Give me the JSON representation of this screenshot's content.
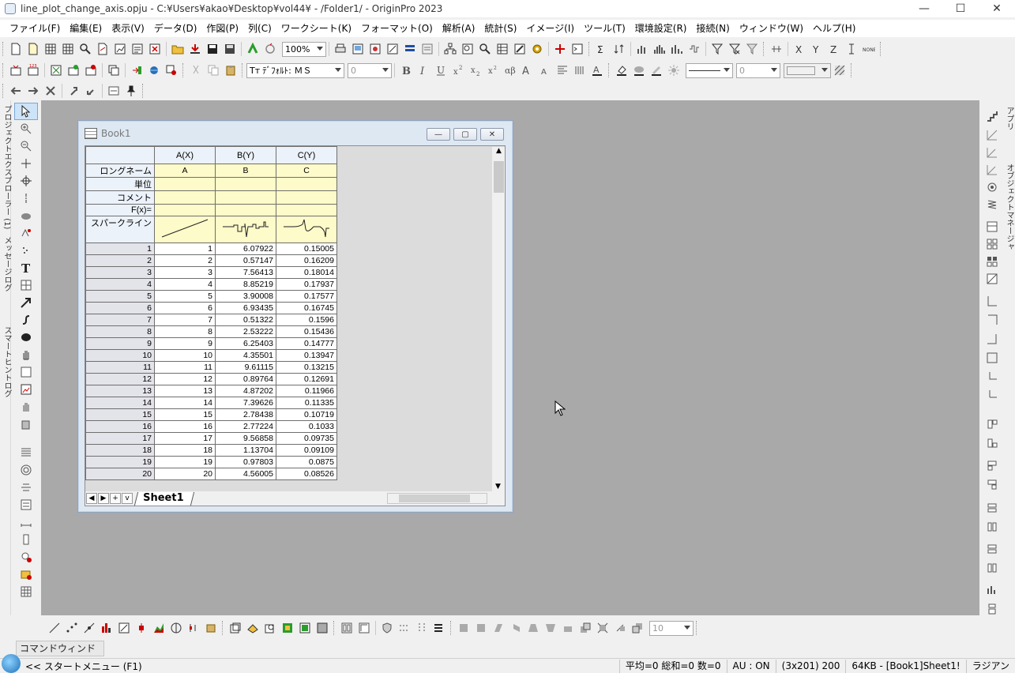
{
  "window": {
    "title": "line_plot_change_axis.opju - C:¥Users¥akao¥Desktop¥vol44¥ - /Folder1/ - OriginPro 2023"
  },
  "menu": [
    "ファイル(F)",
    "編集(E)",
    "表示(V)",
    "データ(D)",
    "作図(P)",
    "列(C)",
    "ワークシート(K)",
    "フォーマット(O)",
    "解析(A)",
    "統計(S)",
    "イメージ(I)",
    "ツール(T)",
    "環境設定(R)",
    "接続(N)",
    "ウィンドウ(W)",
    "ヘルプ(H)"
  ],
  "toolbar": {
    "zoom_value": "100%",
    "font_name": "ﾃﾞﾌｫﾙﾄ: ＭＳ",
    "font_size": "0",
    "line_width": "0",
    "bottom_size": "10"
  },
  "left_tabs": [
    "プロジェクトエクスプローラー (1)",
    "メッセージログ",
    "スマートヒントログ"
  ],
  "right_tabs": [
    "アプリ",
    "オブジェクトマネージャ"
  ],
  "book": {
    "title": "Book1",
    "columns": [
      "A(X)",
      "B(Y)",
      "C(Y)"
    ],
    "meta_labels": [
      "ロングネーム",
      "単位",
      "コメント",
      "F(x)=",
      "スパークライン"
    ],
    "long_names": [
      "A",
      "B",
      "C"
    ],
    "rows": [
      [
        "1",
        "1",
        "6.07922",
        "0.15005"
      ],
      [
        "2",
        "2",
        "0.57147",
        "0.16209"
      ],
      [
        "3",
        "3",
        "7.56413",
        "0.18014"
      ],
      [
        "4",
        "4",
        "8.85219",
        "0.17937"
      ],
      [
        "5",
        "5",
        "3.90008",
        "0.17577"
      ],
      [
        "6",
        "6",
        "6.93435",
        "0.16745"
      ],
      [
        "7",
        "7",
        "0.51322",
        "0.1596"
      ],
      [
        "8",
        "8",
        "2.53222",
        "0.15436"
      ],
      [
        "9",
        "9",
        "6.25403",
        "0.14777"
      ],
      [
        "10",
        "10",
        "4.35501",
        "0.13947"
      ],
      [
        "11",
        "11",
        "9.61115",
        "0.13215"
      ],
      [
        "12",
        "12",
        "0.89764",
        "0.12691"
      ],
      [
        "13",
        "13",
        "4.87202",
        "0.11966"
      ],
      [
        "14",
        "14",
        "7.39626",
        "0.11335"
      ],
      [
        "15",
        "15",
        "2.78438",
        "0.10719"
      ],
      [
        "16",
        "16",
        "2.77224",
        "0.1033"
      ],
      [
        "17",
        "17",
        "9.56858",
        "0.09735"
      ],
      [
        "18",
        "18",
        "1.13704",
        "0.09109"
      ],
      [
        "19",
        "19",
        "0.97803",
        "0.0875"
      ],
      [
        "20",
        "20",
        "4.56005",
        "0.08526"
      ]
    ],
    "sheet_tab": "Sheet1"
  },
  "command_window": "コマンドウィンドウ",
  "status": {
    "start_menu": "<< スタートメニュー (F1)",
    "stats": "平均=0 総和=0 数=0",
    "au": "AU : ON",
    "dims": "(3x201) 200",
    "mem": "64KB - [Book1]Sheet1!",
    "unit": "ラジアン"
  }
}
